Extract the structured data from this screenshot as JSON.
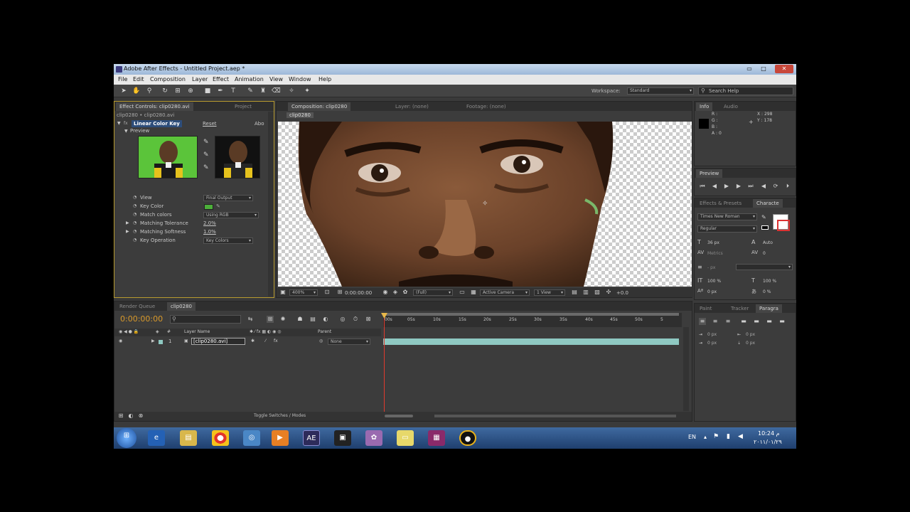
{
  "window": {
    "title": "Adobe After Effects - Untitled Project.aep *",
    "minimize": "▭",
    "maximize": "□",
    "close": "✕"
  },
  "menu": [
    "File",
    "Edit",
    "Composition",
    "Layer",
    "Effect",
    "Animation",
    "View",
    "Window",
    "Help"
  ],
  "toolbar": {
    "workspace_label": "Workspace:",
    "workspace_value": "Standard",
    "search_placeholder": "Search Help"
  },
  "effect_controls": {
    "tab_label": "Effect Controls: clip0280.avi",
    "project_tab": "Project",
    "breadcrumb": "clip0280 • clip0280.avi",
    "effect_name": "Linear Color Key",
    "reset": "Reset",
    "about": "Abo",
    "preview_label": "Preview",
    "properties": [
      {
        "name": "View",
        "value": "Final Output",
        "type": "dropdown"
      },
      {
        "name": "Key Color",
        "value": "",
        "type": "color",
        "color": "#4caf3a"
      },
      {
        "name": "Match colors",
        "value": "Using RGB",
        "type": "dropdown"
      },
      {
        "name": "Matching Tolerance",
        "value": "2.0%",
        "type": "value"
      },
      {
        "name": "Matching Softness",
        "value": "1.0%",
        "type": "value"
      },
      {
        "name": "Key Operation",
        "value": "Key Colors",
        "type": "dropdown"
      }
    ]
  },
  "composition": {
    "tab_label": "Composition: clip0280",
    "layer_tab": "Layer: (none)",
    "footage_tab": "Footage: (none)",
    "comp_name": "clip0280",
    "zoom": "400%",
    "timecode": "0:00:00:00",
    "resolution": "(Full)",
    "camera": "Active Camera",
    "views": "1 View",
    "exposure": "+0.0"
  },
  "info": {
    "tab_info": "Info",
    "tab_audio": "Audio",
    "r": "R :",
    "g": "G :",
    "b": "B :",
    "a": "A : 0",
    "x": "X : 298",
    "y": "Y : 178"
  },
  "preview": {
    "tab": "Preview"
  },
  "effects_presets": {
    "tab": "Effects & Presets",
    "char_tab": "Characte",
    "font": "Times New Roman",
    "style": "Regular",
    "size": "36 px",
    "leading": "Auto",
    "kerning": "Metrics",
    "tracking": "0",
    "stroke_unit": "- px",
    "vscale": "100 %",
    "hscale": "100 %",
    "baseline": "0 px",
    "tsume": "0 %"
  },
  "paragraph": {
    "tab_paint": "Paint",
    "tab_tracker": "Tracker",
    "tab_paragraph": "Paragra",
    "indent1": "0 px",
    "indent2": "0 px",
    "indent3": "0 px",
    "indent4": "0 px"
  },
  "timeline": {
    "render_queue_tab": "Render Queue",
    "comp_tab": "clip0280",
    "timecode": "0:00:00:00",
    "layer_name_header": "Layer Name",
    "parent_header": "Parent",
    "layer_index": "1",
    "layer_name": "[clip0280.avi]",
    "parent_value": "None",
    "ruler": [
      "00s",
      "05s",
      "10s",
      "15s",
      "20s",
      "25s",
      "30s",
      "35s",
      "40s",
      "45s",
      "50s",
      "5"
    ],
    "toggle_label": "Toggle Switches / Modes"
  },
  "taskbar": {
    "lang": "EN",
    "time": "10:24 م",
    "date": "٢٠١١/٠١/٢٩"
  },
  "colors": {
    "key_color": "#4caf3a",
    "accent": "#d99a2b",
    "clip_bar": "#8fc9c2"
  }
}
